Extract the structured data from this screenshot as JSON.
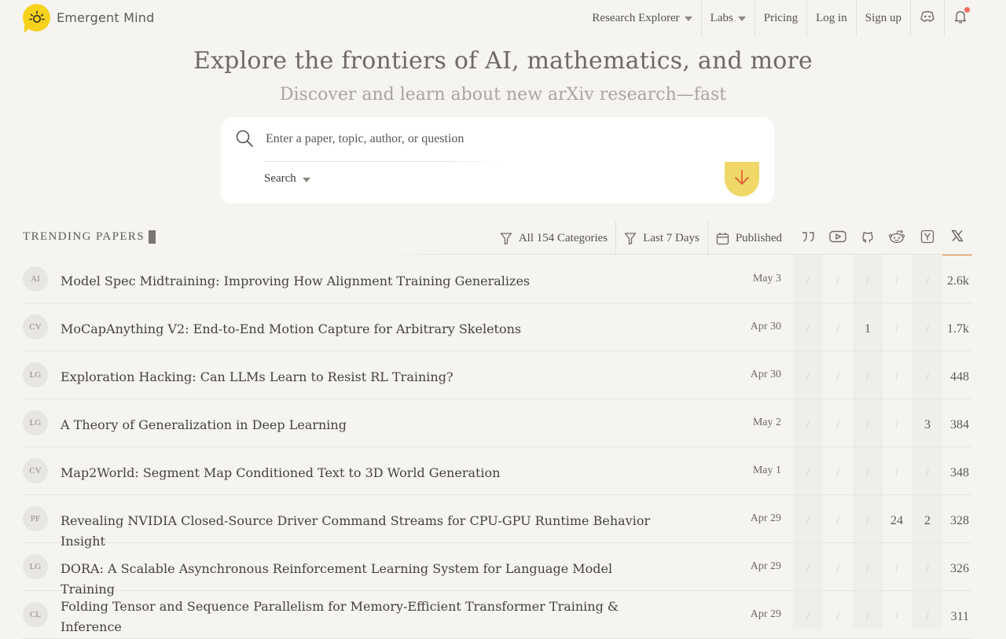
{
  "brand": {
    "name": "Emergent Mind"
  },
  "nav": {
    "research_explorer": "Research Explorer",
    "labs": "Labs",
    "pricing": "Pricing",
    "login": "Log in",
    "signup": "Sign up"
  },
  "hero": {
    "title": "Explore the frontiers of AI, mathematics, and more",
    "subtitle": "Discover and learn about new arXiv research—fast"
  },
  "search": {
    "placeholder": "Enter a paper, topic, author, or question",
    "mode": "Search"
  },
  "trending": {
    "heading": "TRENDING PAPERS",
    "filters": {
      "categories": "All 154 Categories",
      "period": "Last 7 Days",
      "date_type": "Published"
    },
    "columns": [
      "quote-icon",
      "youtube-icon",
      "github-icon",
      "reddit-icon",
      "hackernews-icon",
      "x-icon"
    ],
    "active_sort": "x-icon",
    "empty": "/",
    "rows": [
      {
        "cat": "AI",
        "title": "Model Spec Midtraining: Improving How Alignment Training Generalizes",
        "date": "May 3",
        "metrics": [
          "/",
          "/",
          "/",
          "/",
          "/"
        ],
        "score": "2.6k"
      },
      {
        "cat": "CV",
        "title": "MoCapAnything V2: End-to-End Motion Capture for Arbitrary Skeletons",
        "date": "Apr 30",
        "metrics": [
          "/",
          "/",
          "1",
          "/",
          "/"
        ],
        "score": "1.7k"
      },
      {
        "cat": "LG",
        "title": "Exploration Hacking: Can LLMs Learn to Resist RL Training?",
        "date": "Apr 30",
        "metrics": [
          "/",
          "/",
          "/",
          "/",
          "/"
        ],
        "score": "448"
      },
      {
        "cat": "LG",
        "title": "A Theory of Generalization in Deep Learning",
        "date": "May 2",
        "metrics": [
          "/",
          "/",
          "/",
          "/",
          "3"
        ],
        "score": "384"
      },
      {
        "cat": "CV",
        "title": "Map2World: Segment Map Conditioned Text to 3D World Generation",
        "date": "May 1",
        "metrics": [
          "/",
          "/",
          "/",
          "/",
          "/"
        ],
        "score": "348"
      },
      {
        "cat": "PF",
        "title": "Revealing NVIDIA Closed-Source Driver Command Streams for CPU-GPU Runtime Behavior Insight",
        "date": "Apr 29",
        "metrics": [
          "/",
          "/",
          "/",
          "24",
          "2"
        ],
        "score": "328"
      },
      {
        "cat": "LG",
        "title": "DORA: A Scalable Asynchronous Reinforcement Learning System for Language Model Training",
        "date": "Apr 29",
        "metrics": [
          "/",
          "/",
          "/",
          "/",
          "/"
        ],
        "score": "326"
      },
      {
        "cat": "CL",
        "title": "Folding Tensor and Sequence Parallelism for Memory-Efficient Transformer Training & Inference",
        "date": "Apr 29",
        "metrics": [
          "/",
          "/",
          "/",
          "/",
          "/"
        ],
        "score": "311"
      }
    ]
  },
  "colors": {
    "accent": "#f7d21c",
    "submit": "#efd868",
    "active_tab": "#e9873a",
    "notification": "#ef6a5e",
    "background": "#f5f4f1"
  }
}
